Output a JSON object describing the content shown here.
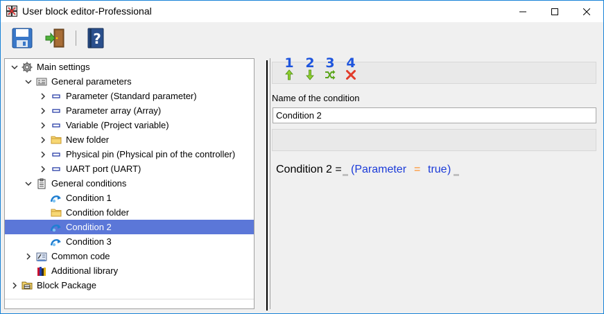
{
  "window": {
    "title": "User block editor-Professional"
  },
  "toolbar": {
    "save": "save-icon",
    "exit": "exit-door-icon",
    "help": "help-book-icon"
  },
  "tree": {
    "items": [
      {
        "label": "Main settings"
      },
      {
        "label": "General parameters"
      },
      {
        "label": "Parameter (Standard parameter)"
      },
      {
        "label": "Parameter array (Array)"
      },
      {
        "label": "Variable (Project variable)"
      },
      {
        "label": "New folder"
      },
      {
        "label": "Physical pin (Physical pin of the controller)"
      },
      {
        "label": "UART port (UART)"
      },
      {
        "label": "General conditions"
      },
      {
        "label": "Condition 1"
      },
      {
        "label": "Condition folder"
      },
      {
        "label": "Condition 2"
      },
      {
        "label": "Condition 3"
      },
      {
        "label": "Common code"
      },
      {
        "label": "Additional library"
      },
      {
        "label": "Block Package"
      }
    ],
    "selected": "Condition 2"
  },
  "actions": {
    "numbers": [
      "1",
      "2",
      "3",
      "4"
    ],
    "icons": [
      "arrow-up-icon",
      "arrow-down-icon",
      "shuffle-icon",
      "delete-icon"
    ]
  },
  "condition": {
    "name_label": "Name of the condition",
    "name_value": "Condition 2",
    "expr_prefix": "Condition 2 =",
    "expr_open": "(Parameter",
    "expr_op": "=",
    "expr_value": "true",
    "expr_close": ")"
  },
  "colors": {
    "selection": "#5b77d8",
    "number_blue": "#1e55dd",
    "expr_blue": "#1a3ad8",
    "expr_operator": "#ff8a1d"
  }
}
